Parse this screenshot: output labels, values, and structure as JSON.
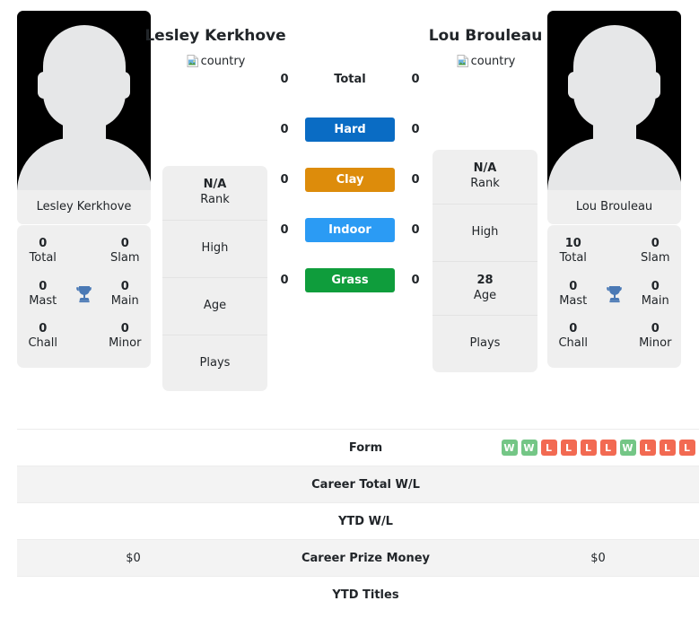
{
  "players": {
    "left": {
      "name": "Lesley Kerkhove",
      "photo_caption": "Lesley Kerkhove",
      "flag_alt": "country",
      "flag_icon": "broken-image-icon",
      "titles": {
        "total_value": "0",
        "total_label": "Total",
        "slam_value": "0",
        "slam_label": "Slam",
        "mast_value": "0",
        "mast_label": "Mast",
        "main_value": "0",
        "main_label": "Main",
        "chall_value": "0",
        "chall_label": "Chall",
        "minor_value": "0",
        "minor_label": "Minor"
      },
      "info": {
        "rank_value": "N/A",
        "rank_label": "Rank",
        "high_value": "",
        "high_label": "High",
        "age_value": "",
        "age_label": "Age",
        "plays_value": "",
        "plays_label": "Plays"
      }
    },
    "right": {
      "name": "Lou Brouleau",
      "photo_caption": "Lou Brouleau",
      "flag_alt": "country",
      "flag_icon": "broken-image-icon",
      "titles": {
        "total_value": "10",
        "total_label": "Total",
        "slam_value": "0",
        "slam_label": "Slam",
        "mast_value": "0",
        "mast_label": "Mast",
        "main_value": "0",
        "main_label": "Main",
        "chall_value": "0",
        "chall_label": "Chall",
        "minor_value": "0",
        "minor_label": "Minor"
      },
      "info": {
        "rank_value": "N/A",
        "rank_label": "Rank",
        "high_value": "",
        "high_label": "High",
        "age_value": "28",
        "age_label": "Age",
        "plays_value": "",
        "plays_label": "Plays"
      }
    }
  },
  "trophy_icon": "trophy-icon",
  "surfaces": [
    {
      "label": "Total",
      "left_value": "0",
      "right_value": "0",
      "badge": false,
      "color": ""
    },
    {
      "label": "Hard",
      "left_value": "0",
      "right_value": "0",
      "badge": true,
      "color": "#0a6cc4"
    },
    {
      "label": "Clay",
      "left_value": "0",
      "right_value": "0",
      "badge": true,
      "color": "#dd8c0b"
    },
    {
      "label": "Indoor",
      "left_value": "0",
      "right_value": "0",
      "badge": true,
      "color": "#2b9bf4"
    },
    {
      "label": "Grass",
      "left_value": "0",
      "right_value": "0",
      "badge": true,
      "color": "#0f9d3c"
    }
  ],
  "table": {
    "rows": [
      {
        "label": "Form",
        "left": "",
        "right": "",
        "left_form": [],
        "right_form": [
          "W",
          "W",
          "L",
          "L",
          "L",
          "L",
          "W",
          "L",
          "L",
          "L"
        ],
        "shade": false
      },
      {
        "label": "Career Total W/L",
        "left": "",
        "right": "",
        "left_form": [],
        "right_form": [],
        "shade": true
      },
      {
        "label": "YTD W/L",
        "left": "",
        "right": "",
        "left_form": [],
        "right_form": [],
        "shade": false
      },
      {
        "label": "Career Prize Money",
        "left": "$0",
        "right": "$0",
        "left_form": [],
        "right_form": [],
        "shade": true
      },
      {
        "label": "YTD Titles",
        "left": "",
        "right": "",
        "left_form": [],
        "right_form": [],
        "shade": false
      }
    ],
    "form_colors": {
      "W": "#74c686",
      "L": "#f26a52"
    }
  }
}
